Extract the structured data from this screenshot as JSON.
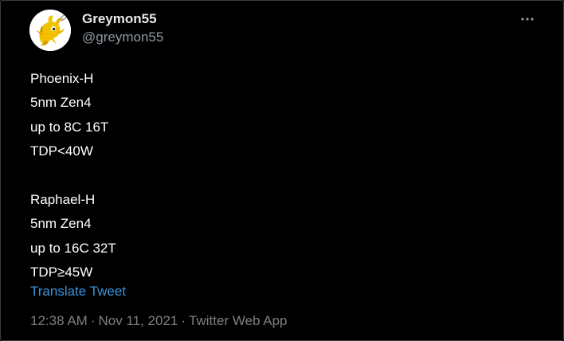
{
  "author": {
    "display_name": "Greymon55",
    "handle": "@greymon55",
    "avatar_icon": "yellow-dragon-avatar"
  },
  "menu": {
    "icon": "more-dots-icon"
  },
  "tweet": {
    "lines": [
      "Phoenix-H",
      "5nm Zen4",
      "up to 8C 16T",
      "TDP<40W",
      "",
      "Raphael-H",
      "5nm Zen4",
      "up to 16C 32T",
      "TDP≥45W"
    ],
    "translate_label": "Translate Tweet"
  },
  "meta": {
    "time": "12:38 AM",
    "separator": "·",
    "date": "Nov 11, 2021",
    "source": "Twitter Web App"
  },
  "colors": {
    "background": "#000000",
    "text": "#ffffff",
    "secondary": "#7b8085",
    "link": "#3b94d9"
  }
}
